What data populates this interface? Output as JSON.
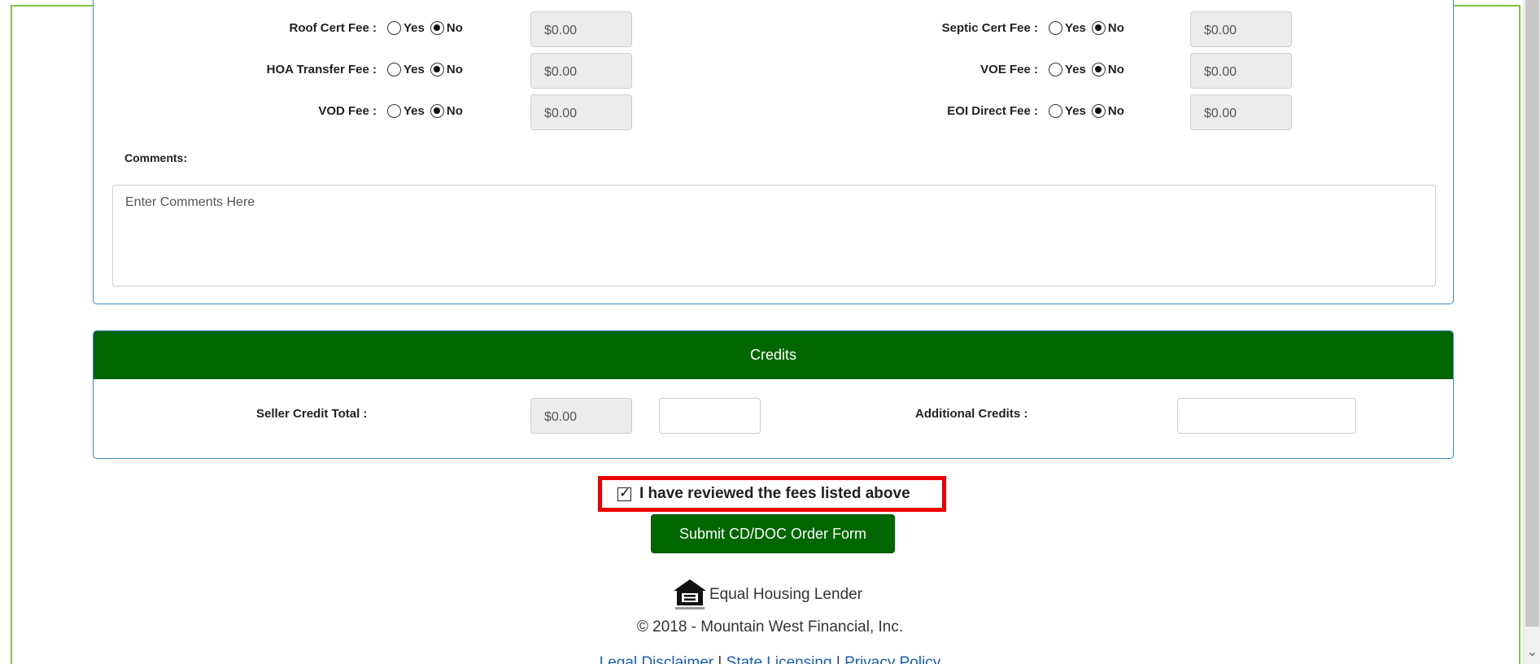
{
  "fees": {
    "left": [
      {
        "label": "Roof Cert Fee :",
        "yes": "Yes",
        "no": "No",
        "selected": "No",
        "amount": "$0.00"
      },
      {
        "label": "HOA Transfer Fee :",
        "yes": "Yes",
        "no": "No",
        "selected": "No",
        "amount": "$0.00"
      },
      {
        "label": "VOD Fee :",
        "yes": "Yes",
        "no": "No",
        "selected": "No",
        "amount": "$0.00"
      }
    ],
    "right": [
      {
        "label": "Septic Cert Fee :",
        "yes": "Yes",
        "no": "No",
        "selected": "No",
        "amount": "$0.00"
      },
      {
        "label": "VOE Fee :",
        "yes": "Yes",
        "no": "No",
        "selected": "No",
        "amount": "$0.00"
      },
      {
        "label": "EOI Direct Fee :",
        "yes": "Yes",
        "no": "No",
        "selected": "No",
        "amount": "$0.00"
      }
    ]
  },
  "comments": {
    "label": "Comments:",
    "placeholder": "Enter Comments Here"
  },
  "credits": {
    "header": "Credits",
    "seller_credit_label": "Seller Credit Total :",
    "seller_credit_amount": "$0.00",
    "additional_credits_label": "Additional Credits :"
  },
  "review": {
    "label": "I have reviewed the fees listed above",
    "checked": true
  },
  "submit": {
    "label": "Submit CD/DOC Order Form"
  },
  "footer": {
    "ehl_text": "Equal Housing Lender",
    "copyright": "© 2018 - Mountain West Financial, Inc.",
    "links": [
      "Legal Disclaimer",
      "State Licensing",
      "Privacy Policy"
    ],
    "separator": "|"
  },
  "colors": {
    "brand_green": "#006600",
    "frame_green": "#7cc44a",
    "panel_border": "#3a8ac8",
    "highlight_red": "#ee0000"
  }
}
